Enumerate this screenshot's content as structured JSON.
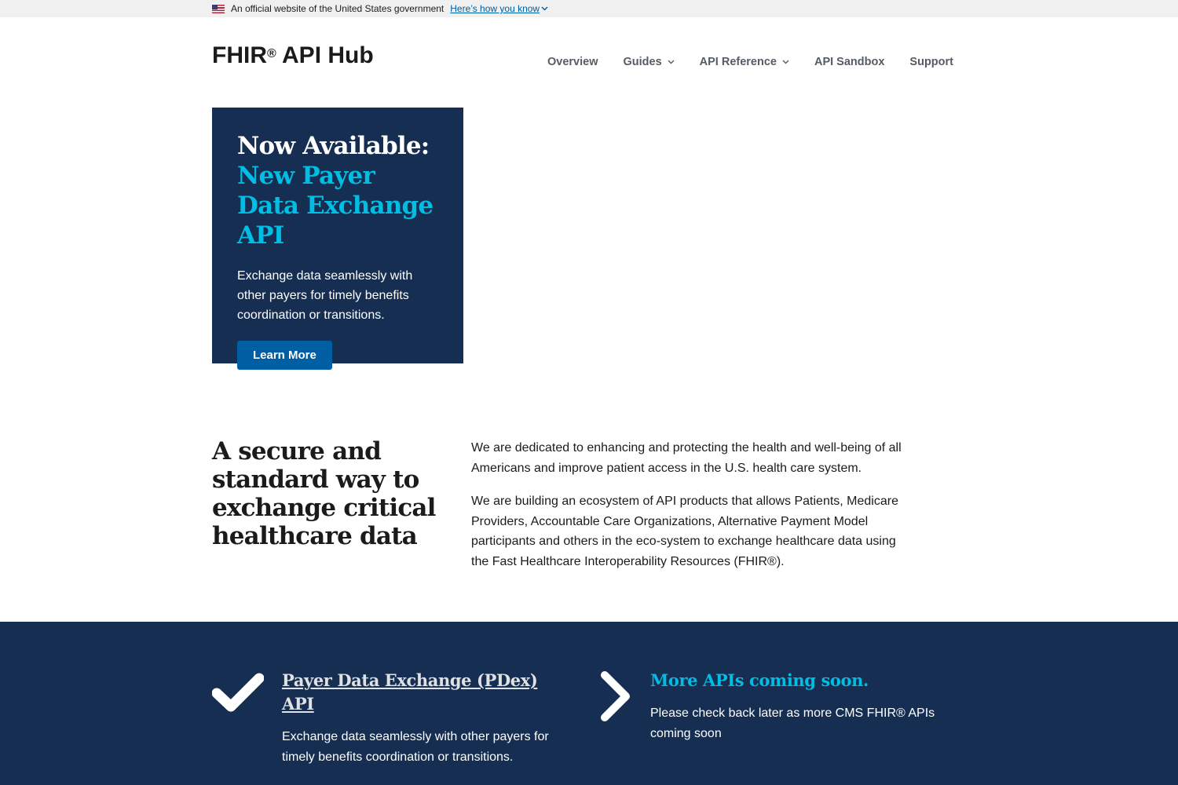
{
  "gov_banner": {
    "text": "An official website of the United States government",
    "link_label": "Here’s how you know"
  },
  "header": {
    "title": "FHIR",
    "title_mark": "®",
    "title_suffix": " API Hub",
    "nav": {
      "overview": "Overview",
      "guides": "Guides",
      "api_reference": "API Reference",
      "api_sandbox": "API Sandbox",
      "support": "Support"
    }
  },
  "hero": {
    "title_line": "Now Available:",
    "title_accent": "New Payer Data Exchange API",
    "description": "Exchange data seamlessly with other payers for timely benefits coordination or transitions.",
    "button_label": "Learn More"
  },
  "intro": {
    "heading": "A secure and standard way to exchange critical healthcare data",
    "paragraph_1": "We are dedicated to enhancing and protecting the health and well-being of all Americans and improve patient access in the U.S. health care system.",
    "paragraph_2": "We are building an ecosystem of API products that allows Patients, Medicare Providers, Accountable Care Organizations, Alternative Payment Model participants and others in the eco-system to exchange healthcare data using the Fast Healthcare Interoperability Resources (FHIR®)."
  },
  "features": [
    {
      "icon": "checkmark-icon",
      "title": "Payer Data Exchange (PDex) API",
      "description": "Exchange data seamlessly with other payers for timely benefits coordination or transitions."
    },
    {
      "icon": "chevron-right-icon",
      "title": "More APIs coming soon.",
      "description": "Please check back later as more CMS FHIR® APIs coming soon"
    }
  ],
  "colors": {
    "navy": "#162e51",
    "cyan": "#00bde3",
    "primary_blue": "#005ea2",
    "banner_gray": "#f0f0f0"
  }
}
